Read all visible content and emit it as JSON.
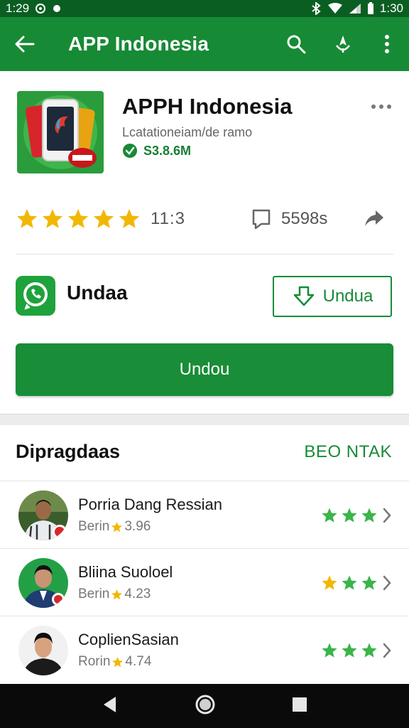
{
  "status_bar": {
    "time": "1:29",
    "time_right": "1:30"
  },
  "app_bar": {
    "title": "APP Indonesia"
  },
  "app": {
    "name": "APPH Indonesia",
    "developer": "Lcatationeiam/de ramo",
    "verified_text": "S3.8.6M"
  },
  "stats": {
    "rating": "11:3",
    "reviews": "5598s"
  },
  "install": {
    "label": "Undaa",
    "outline_button": "Undua",
    "main_button": "Undou"
  },
  "section": {
    "title": "Dipragdaas",
    "link": "BEO NTAK",
    "items": [
      {
        "name": "Porria Dang Ressian",
        "meta_prefix": "Berin",
        "meta_value": "3.96",
        "stars": 3,
        "star_color": "green"
      },
      {
        "name": "Bliina Suoloel",
        "meta_prefix": "Berin",
        "meta_value": "4.23",
        "stars": 3,
        "star_color": "mixed"
      },
      {
        "name": "CoplienSasian",
        "meta_prefix": "Rorin",
        "meta_value": "4.74",
        "stars": 3,
        "star_color": "green"
      }
    ]
  },
  "colors": {
    "primary": "#178a35",
    "primary_dark": "#0b5e22",
    "star_gold": "#f2b705",
    "star_green": "#3bb54a"
  }
}
